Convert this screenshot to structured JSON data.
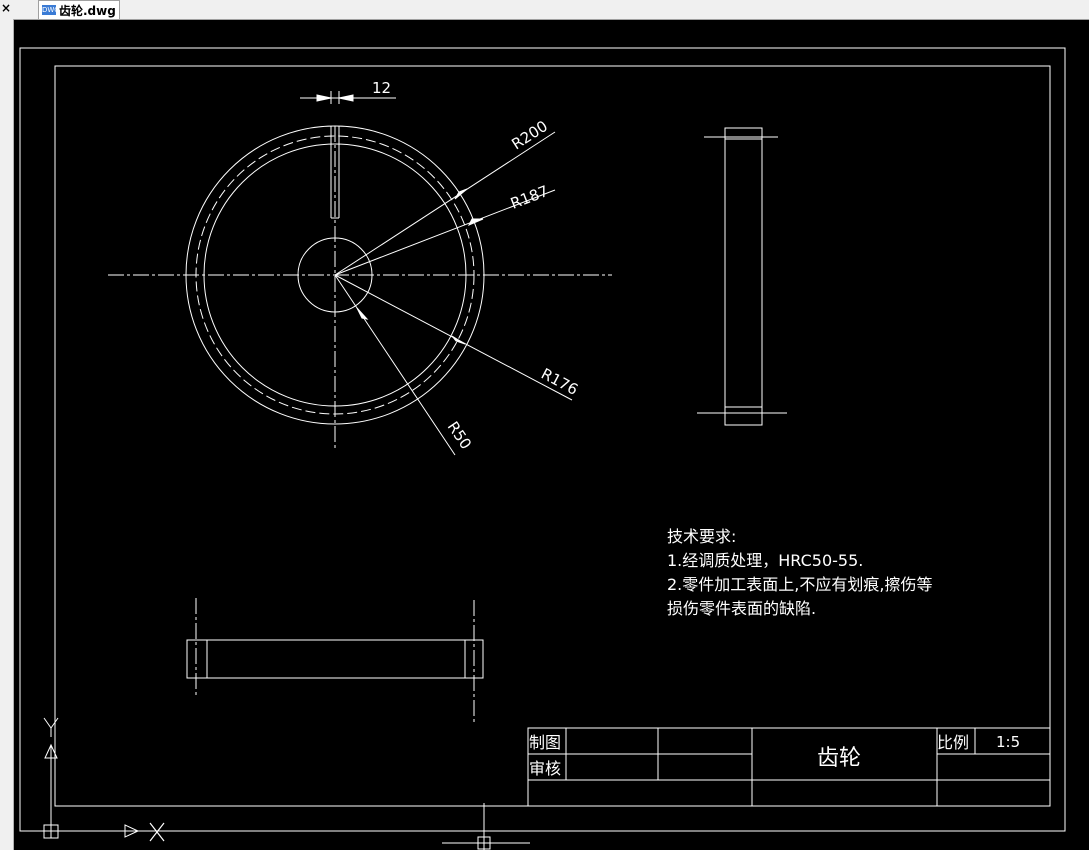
{
  "window": {
    "close_glyph": "×",
    "tab_label": "齿轮.dwg",
    "tab_icon_text": "DWG"
  },
  "drawing": {
    "dim_width": "12",
    "dim_r200": "R200",
    "dim_r187": "R187",
    "dim_r176": "R176",
    "dim_r50": "R50",
    "tech_title": "技术要求:",
    "tech_line1": "1.经调质处理，HRC50-55.",
    "tech_line2": "2.零件加工表面上,不应有划痕,擦伤等",
    "tech_line3": "损伤零件表面的缺陷.",
    "title_block": {
      "drawn_by": "制图",
      "reviewed_by": "审核",
      "part_name": "齿轮",
      "scale_label": "比例",
      "scale_value": "1:5"
    },
    "ucs_x": "X",
    "ucs_y": "Y"
  },
  "colors": {
    "background": "#000000",
    "lines": "#ffffff",
    "text": "#ffffff"
  }
}
